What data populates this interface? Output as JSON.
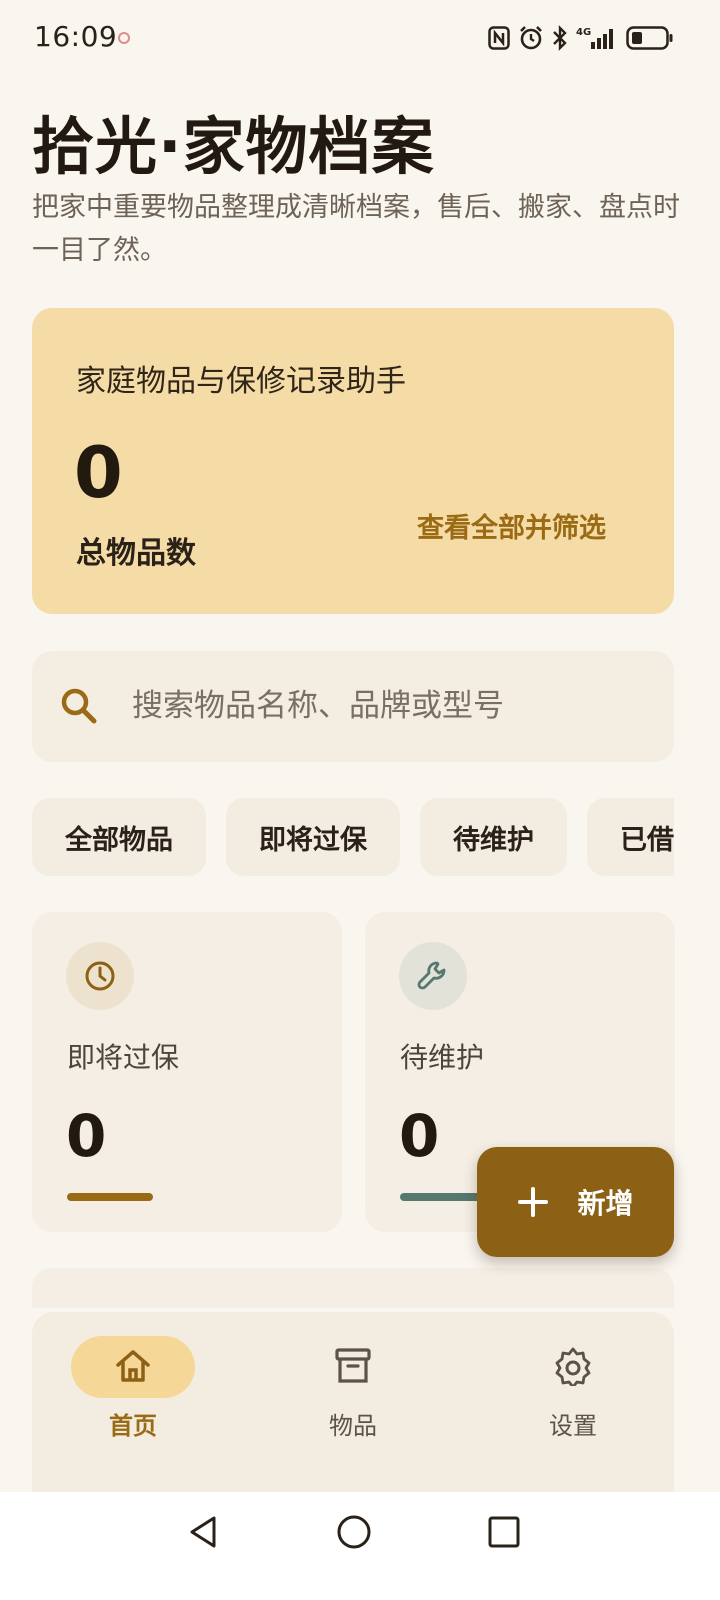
{
  "status_bar": {
    "time": "16:09",
    "icons": [
      "nfc-icon",
      "alarm-icon",
      "bluetooth-icon",
      "signal-4g-icon",
      "battery-icon"
    ],
    "network": "4G"
  },
  "header": {
    "title": "拾光·家物档案",
    "subtitle": "把家中重要物品整理成清晰档案，售后、搬家、盘点时一目了然。"
  },
  "hero": {
    "caption": "家庭物品与保修记录助手",
    "total_value": "0",
    "total_label": "总物品数",
    "link_label": "查看全部并筛选"
  },
  "search": {
    "placeholder": "搜索物品名称、品牌或型号",
    "value": ""
  },
  "filters": {
    "chips": [
      {
        "label": "全部物品"
      },
      {
        "label": "即将过保"
      },
      {
        "label": "待维护"
      },
      {
        "label": "已借出"
      }
    ]
  },
  "stats": {
    "expiring": {
      "label": "即将过保",
      "value": "0",
      "icon": "clock-icon"
    },
    "maintenance": {
      "label": "待维护",
      "value": "0",
      "icon": "wrench-icon"
    }
  },
  "fab": {
    "label": "新增",
    "icon": "plus-icon"
  },
  "bottom_nav": {
    "items": [
      {
        "label": "首页",
        "icon": "home-icon",
        "active": true
      },
      {
        "label": "物品",
        "icon": "archive-box-icon",
        "active": false
      },
      {
        "label": "设置",
        "icon": "gear-icon",
        "active": false
      }
    ]
  },
  "colors": {
    "background": "#f9f5ef",
    "hero_card": "#f5dca7",
    "accent": "#8c6115",
    "accent_text": "#9a6b14",
    "teal": "#56786e",
    "surface": "#f4eee4"
  }
}
